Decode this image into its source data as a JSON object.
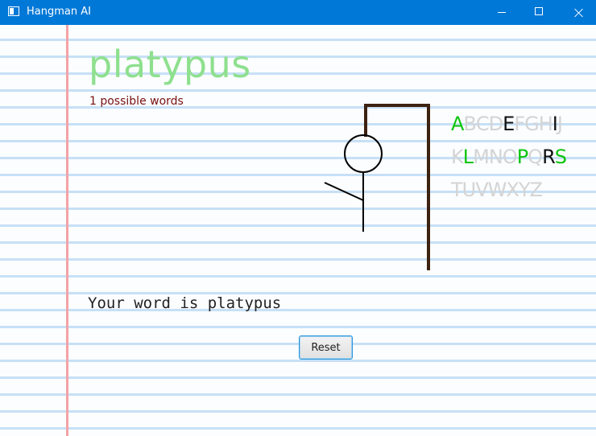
{
  "window": {
    "title": "Hangman AI",
    "icon": "app-window-icon"
  },
  "game": {
    "word": "platypus",
    "possible_words": "1 possible words",
    "message": "Your word is platypus",
    "reset_label": "Reset"
  },
  "alphabet": {
    "rows": [
      [
        {
          "letter": "A",
          "state": "correct"
        },
        {
          "letter": "B",
          "state": "unused"
        },
        {
          "letter": "C",
          "state": "unused"
        },
        {
          "letter": "D",
          "state": "unused"
        },
        {
          "letter": "E",
          "state": "wrong"
        },
        {
          "letter": "F",
          "state": "unused"
        },
        {
          "letter": "G",
          "state": "unused"
        },
        {
          "letter": "H",
          "state": "unused"
        },
        {
          "letter": "I",
          "state": "wrong"
        },
        {
          "letter": "J",
          "state": "unused"
        }
      ],
      [
        {
          "letter": "K",
          "state": "unused"
        },
        {
          "letter": "L",
          "state": "correct"
        },
        {
          "letter": "M",
          "state": "unused"
        },
        {
          "letter": "N",
          "state": "unused"
        },
        {
          "letter": "O",
          "state": "unused"
        },
        {
          "letter": "P",
          "state": "correct"
        },
        {
          "letter": "Q",
          "state": "unused"
        },
        {
          "letter": "R",
          "state": "wrong"
        },
        {
          "letter": "S",
          "state": "correct"
        }
      ],
      [
        {
          "letter": "T",
          "state": "unused"
        },
        {
          "letter": "U",
          "state": "unused"
        },
        {
          "letter": "V",
          "state": "unused"
        },
        {
          "letter": "W",
          "state": "unused"
        },
        {
          "letter": "X",
          "state": "unused"
        },
        {
          "letter": "Y",
          "state": "unused"
        },
        {
          "letter": "Z",
          "state": "unused"
        }
      ]
    ]
  },
  "colors": {
    "titlebar": "#0078d7",
    "word": "#8ee08e",
    "count": "#7a1010",
    "letter_correct": "#0ec40e",
    "letter_wrong": "#111111",
    "letter_unused": "#d4d4d4",
    "gallows": "#3d2210",
    "margin_line": "#f4a2a6",
    "ruled_line": "#c7e0f6"
  }
}
